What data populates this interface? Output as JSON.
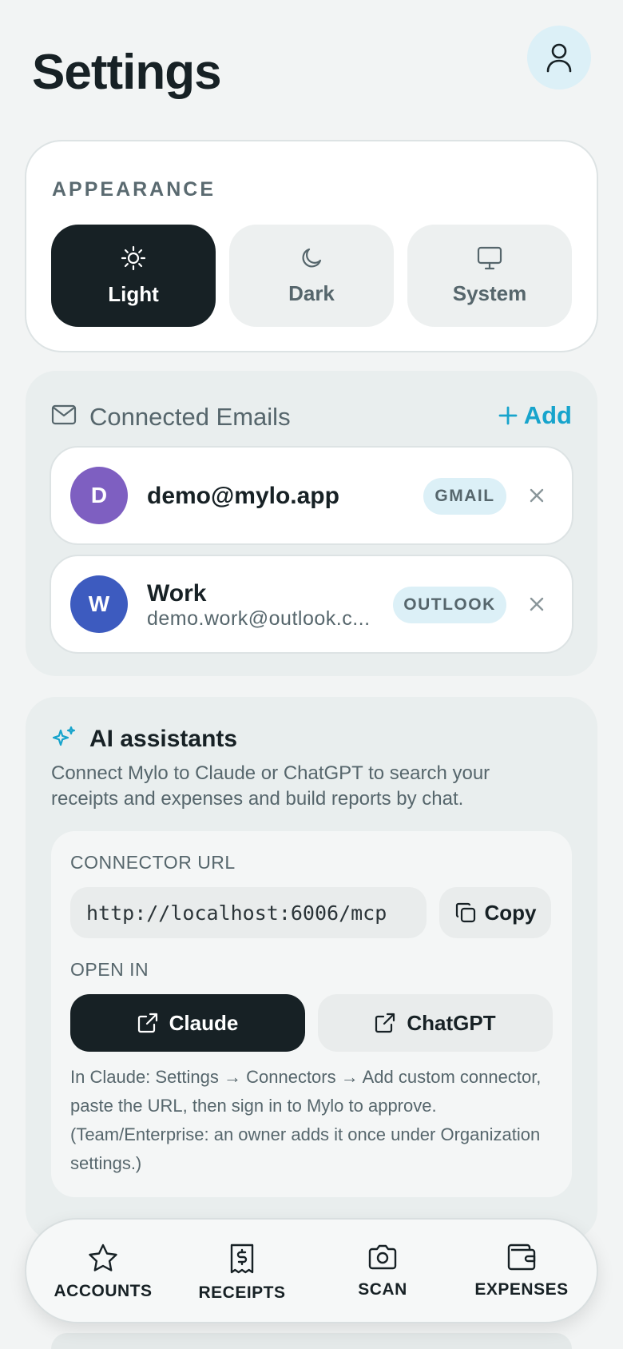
{
  "header": {
    "title": "Settings",
    "profile_icon": "user-icon"
  },
  "appearance": {
    "label": "APPEARANCE",
    "options": [
      {
        "label": "Light",
        "icon": "sun-icon",
        "selected": true
      },
      {
        "label": "Dark",
        "icon": "moon-icon",
        "selected": false
      },
      {
        "label": "System",
        "icon": "monitor-icon",
        "selected": false
      }
    ]
  },
  "emails": {
    "title": "Connected Emails",
    "add_label": "Add",
    "accounts": [
      {
        "initial": "D",
        "avatar_color": "#7e5fc1",
        "name": "demo@mylo.app",
        "provider": "GMAIL"
      },
      {
        "initial": "W",
        "avatar_color": "#3d5bbf",
        "name": "Work",
        "address": "demo.work@outlook.c...",
        "provider": "OUTLOOK"
      }
    ]
  },
  "ai": {
    "title": "AI assistants",
    "description": "Connect Mylo to Claude or ChatGPT to search your receipts and expenses and build reports by chat.",
    "connector_label": "CONNECTOR URL",
    "connector_url": "http://localhost:6006/mcp",
    "copy_label": "Copy",
    "open_in_label": "OPEN IN",
    "claude_label": "Claude",
    "chatgpt_label": "ChatGPT",
    "instructions": "In Claude: Settings → Connectors → Add custom connector, paste the URL, then sign in to Mylo to approve. (Team/Enterprise: an owner adds it once under Organization settings.)"
  },
  "nav": {
    "items": [
      {
        "label": "ACCOUNTS",
        "icon": "star-icon"
      },
      {
        "label": "RECEIPTS",
        "icon": "receipt-icon"
      },
      {
        "label": "SCAN",
        "icon": "camera-icon"
      },
      {
        "label": "EXPENSES",
        "icon": "wallet-icon"
      }
    ]
  },
  "colors": {
    "accent": "#17a4cc",
    "dark": "#172125",
    "badge_bg": "#dcf0f7"
  }
}
